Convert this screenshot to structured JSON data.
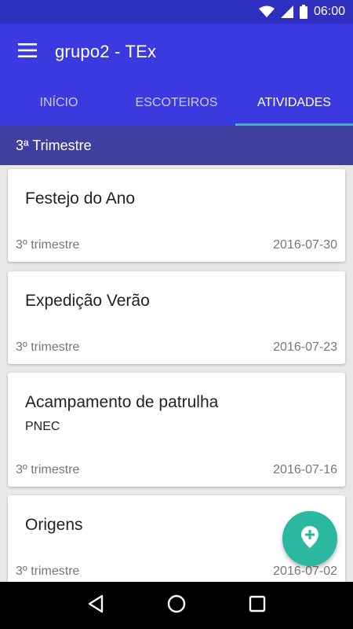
{
  "status_bar": {
    "time": "06:00",
    "icons": [
      "wifi-icon",
      "signal-icon",
      "battery-icon"
    ]
  },
  "app_bar": {
    "title": "grupo2 - TEx",
    "menu_icon": "menu-icon",
    "background": "#3a3ae0"
  },
  "tabs": [
    {
      "label": "INÍCIO",
      "active": false
    },
    {
      "label": "ESCOTEIROS",
      "active": false
    },
    {
      "label": "ATIVIDADES",
      "active": true
    }
  ],
  "accent_color": "#27c0a2",
  "section": {
    "title": "3ª Trimestre"
  },
  "activities": [
    {
      "title": "Festejo do Ano",
      "subtitle": "",
      "period": "3º trimestre",
      "date": "2016-07-30"
    },
    {
      "title": "Expedição Verão",
      "subtitle": "",
      "period": "3º trimestre",
      "date": "2016-07-23"
    },
    {
      "title": "Acampamento de patrulha",
      "subtitle": "PNEC",
      "period": "3º trimestre",
      "date": "2016-07-16"
    },
    {
      "title": "Origens",
      "subtitle": "",
      "period": "3º trimestre",
      "date": "2016-07-02"
    }
  ],
  "fab": {
    "icon": "add-location-icon",
    "color": "#2ab8a0"
  },
  "nav_bar": {
    "icons": [
      "back-icon",
      "home-icon",
      "recents-icon"
    ]
  }
}
